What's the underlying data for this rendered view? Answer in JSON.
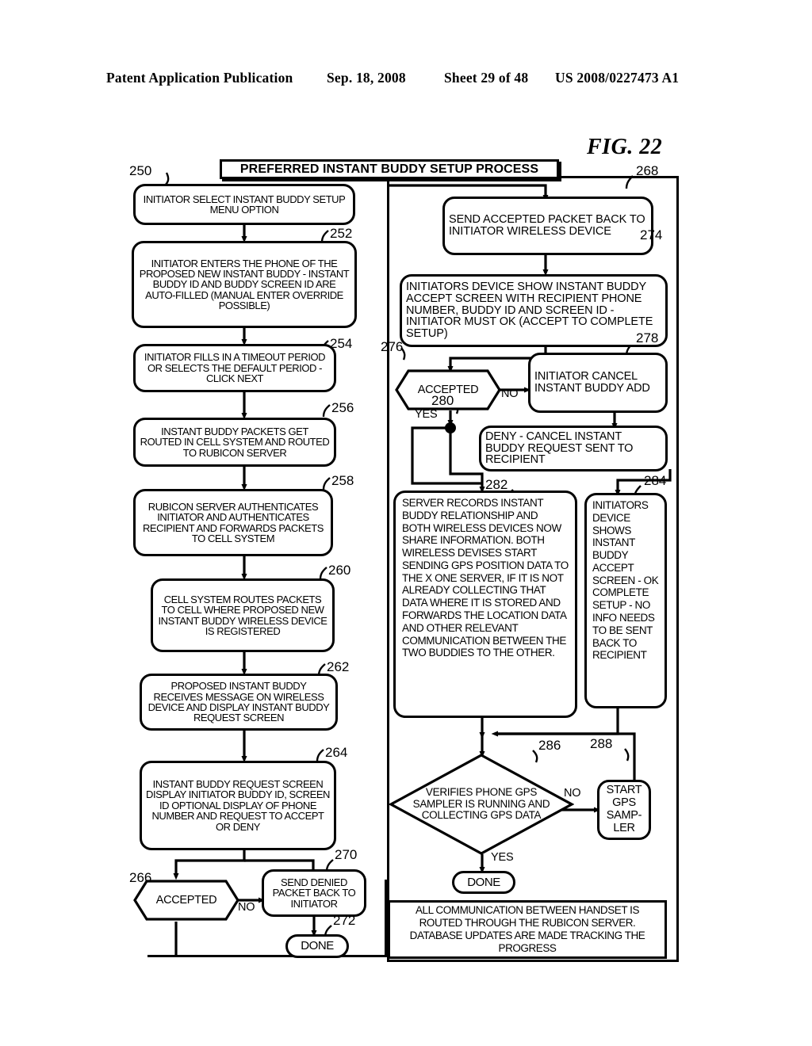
{
  "header": {
    "publication": "Patent Application Publication",
    "date": "Sep. 18, 2008",
    "sheet": "Sheet 29 of 48",
    "number": "US 2008/0227473 A1"
  },
  "figure": {
    "label": "FIG. 22"
  },
  "banner": {
    "title": "PREFERRED INSTANT BUDDY SETUP PROCESS"
  },
  "refs": {
    "r250": "250",
    "r252": "252",
    "r254": "254",
    "r256": "256",
    "r258": "258",
    "r260": "260",
    "r262": "262",
    "r264": "264",
    "r266": "266",
    "r268": "268",
    "r270": "270",
    "r272": "272",
    "r274": "274",
    "r276": "276",
    "r278": "278",
    "r280": "280",
    "r282": "282",
    "r284": "284",
    "r286": "286",
    "r288": "288"
  },
  "branches": {
    "no_266": "NO",
    "no_276": "NO",
    "yes_276": "YES",
    "no_286": "NO",
    "yes_286": "YES"
  },
  "nodes": {
    "n250": "INITIATOR SELECT INSTANT BUDDY SETUP MENU OPTION",
    "n252": "INITIATOR ENTERS THE PHONE OF THE PROPOSED NEW INSTANT BUDDY - INSTANT BUDDY ID AND BUDDY SCREEN ID ARE AUTO-FILLED (MANUAL ENTER OVERRIDE POSSIBLE)",
    "n254": "INITIATOR FILLS IN A TIMEOUT PERIOD OR SELECTS THE DEFAULT PERIOD - CLICK NEXT",
    "n256": "INSTANT BUDDY PACKETS GET ROUTED IN CELL SYSTEM AND ROUTED TO RUBICON SERVER",
    "n258": "RUBICON SERVER AUTHENTICATES INITIATOR AND AUTHENTICATES RECIPIENT AND FORWARDS PACKETS TO CELL SYSTEM",
    "n260": "CELL SYSTEM ROUTES PACKETS TO CELL WHERE PROPOSED NEW INSTANT BUDDY WIRELESS DEVICE IS REGISTERED",
    "n262": "PROPOSED INSTANT BUDDY RECEIVES MESSAGE ON WIRELESS DEVICE AND DISPLAY INSTANT BUDDY REQUEST SCREEN",
    "n264": "INSTANT BUDDY REQUEST SCREEN DISPLAY INITIATOR BUDDY ID, SCREEN ID OPTIONAL DISPLAY OF PHONE NUMBER AND REQUEST TO ACCEPT OR DENY",
    "n266": "ACCEPTED",
    "n268": "SEND ACCEPTED PACKET BACK TO INITIATOR WIRELESS DEVICE",
    "n270": "SEND DENIED PACKET BACK TO INITIATOR",
    "n272": "DONE",
    "n274": "INITIATORS DEVICE SHOW INSTANT BUDDY ACCEPT SCREEN WITH RECIPIENT PHONE NUMBER, BUDDY ID AND SCREEN ID - INITIATOR MUST OK (ACCEPT TO COMPLETE SETUP)",
    "n276": "ACCEPTED",
    "n278": "INITIATOR CANCEL INSTANT BUDDY ADD",
    "n280": "DENY - CANCEL INSTANT BUDDY REQUEST SENT TO RECIPIENT",
    "n282": "SERVER RECORDS INSTANT BUDDY RELATIONSHIP AND BOTH WIRELESS DEVICES NOW SHARE INFORMATION. BOTH WIRELESS DEVISES START SENDING GPS POSITION DATA TO THE X ONE SERVER, IF IT IS NOT ALREADY COLLECTING THAT DATA WHERE IT IS STORED AND FORWARDS THE LOCATION DATA AND OTHER RELEVANT COMMUNICATION BETWEEN THE TWO BUDDIES TO THE OTHER.",
    "n284": "INITIATORS DEVICE SHOWS INSTANT BUDDY ACCEPT SCREEN - OK COMPLETE SETUP - NO INFO NEEDS TO BE SENT BACK TO RECIPIENT",
    "n286": "VERIFIES PHONE GPS SAMPLER IS RUNNING AND COLLECTING GPS DATA",
    "n288": "START GPS SAMP-LER",
    "n_done_bottom": "DONE",
    "n_note": "ALL COMMUNICATION BETWEEN HANDSET IS ROUTED THROUGH THE RUBICON SERVER. DATABASE UPDATES ARE MADE TRACKING THE PROGRESS"
  },
  "colors": {
    "ink": "#000000",
    "paper": "#ffffff"
  }
}
